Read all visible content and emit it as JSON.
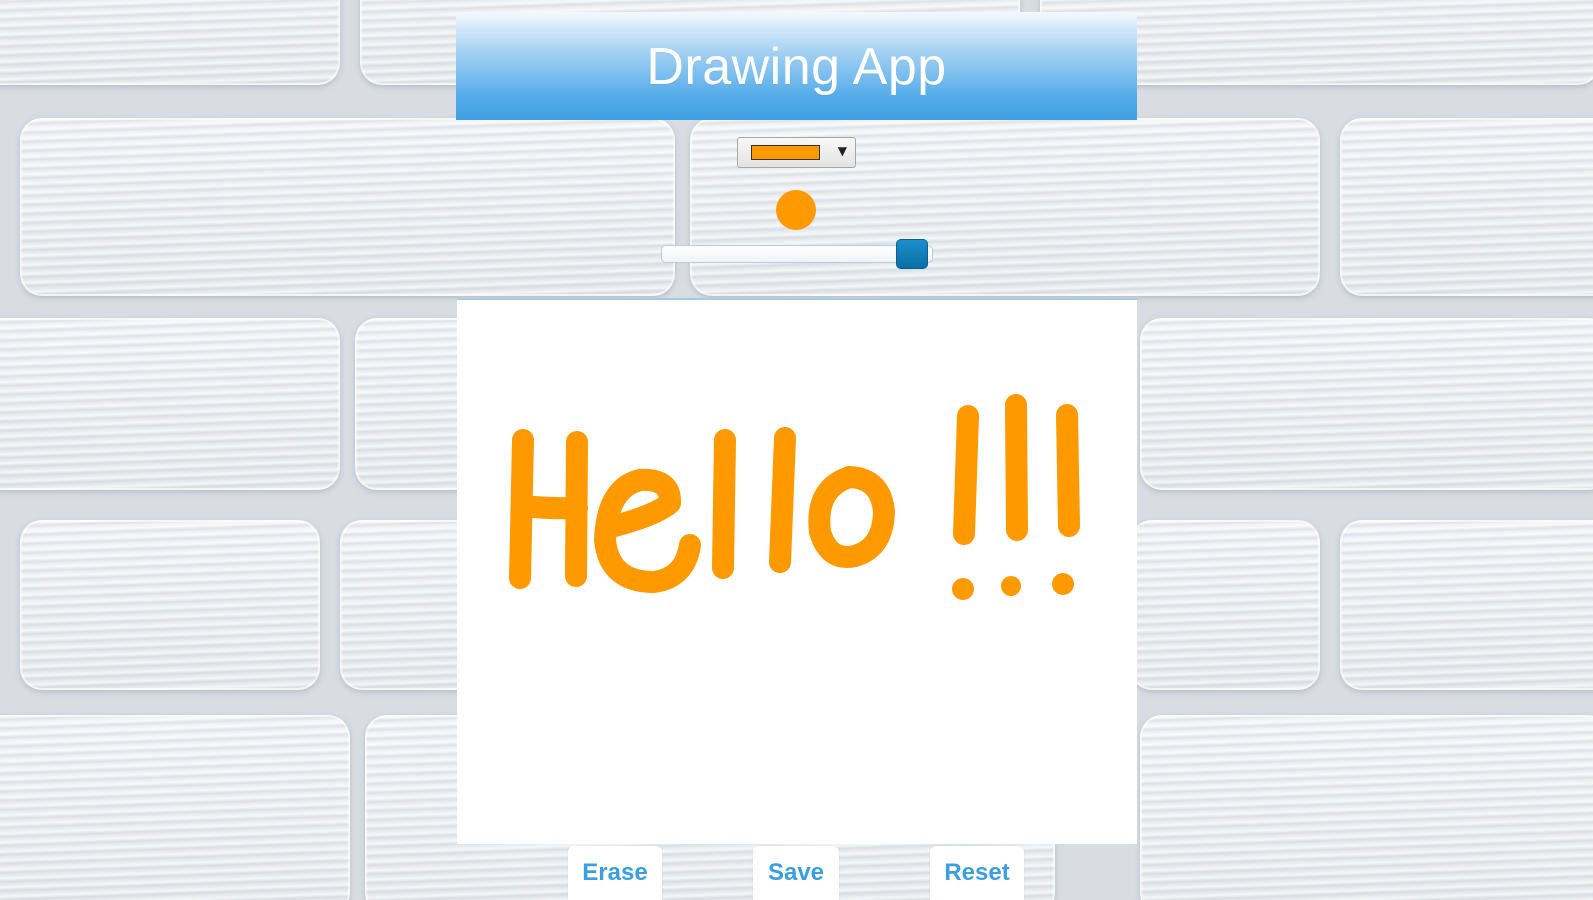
{
  "app": {
    "title": "Drawing App"
  },
  "controls": {
    "selected_color": "#ff9900",
    "brush_size_fraction": 0.98
  },
  "canvas": {
    "stroke_color": "#ff9900",
    "background": "#ffffff"
  },
  "buttons": {
    "erase_label": "Erase",
    "save_label": "Save",
    "reset_label": "Reset"
  },
  "colors": {
    "header_blue": "#3e9fe2",
    "button_text": "#3a9fe0",
    "slider_handle": "#0a6ea8"
  }
}
